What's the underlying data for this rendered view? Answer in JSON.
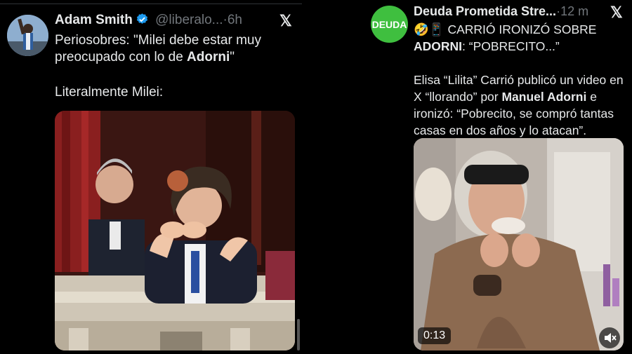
{
  "left_tweet": {
    "author_name": "Adam Smith",
    "handle": "@liberalo...",
    "separator": "·",
    "time": "6h",
    "body_line1_prefix": "Periosobres: \"Milei debe estar muy preocupado con lo de ",
    "body_line1_bold": "Adorni",
    "body_line1_suffix": "\"",
    "body_line2": "Literalmente Milei:",
    "verified_color": "#1d9bf0"
  },
  "right_tweet": {
    "author_name": "Deuda Prometida Stre...",
    "separator": "·",
    "time": "12 m",
    "avatar_text": "DEUDA",
    "avatar_color": "#3fbf3f",
    "headline_emoji": "🤣📱",
    "headline_part1": " CARRIÓ IRONIZÓ SOBRE ",
    "headline_bold": "ADORNI",
    "headline_part2": ": “POBRECITO...”",
    "body_part1": "Elisa “Lilita” Carrió publicó un video en X “llorando” por ",
    "body_bold": "Manuel Adorni",
    "body_part2": " e ironizó: “Pobrecito, se compró tantas casas en dos años y lo atacan”.",
    "video_time": "0:13"
  },
  "x_logo": "𝕏"
}
